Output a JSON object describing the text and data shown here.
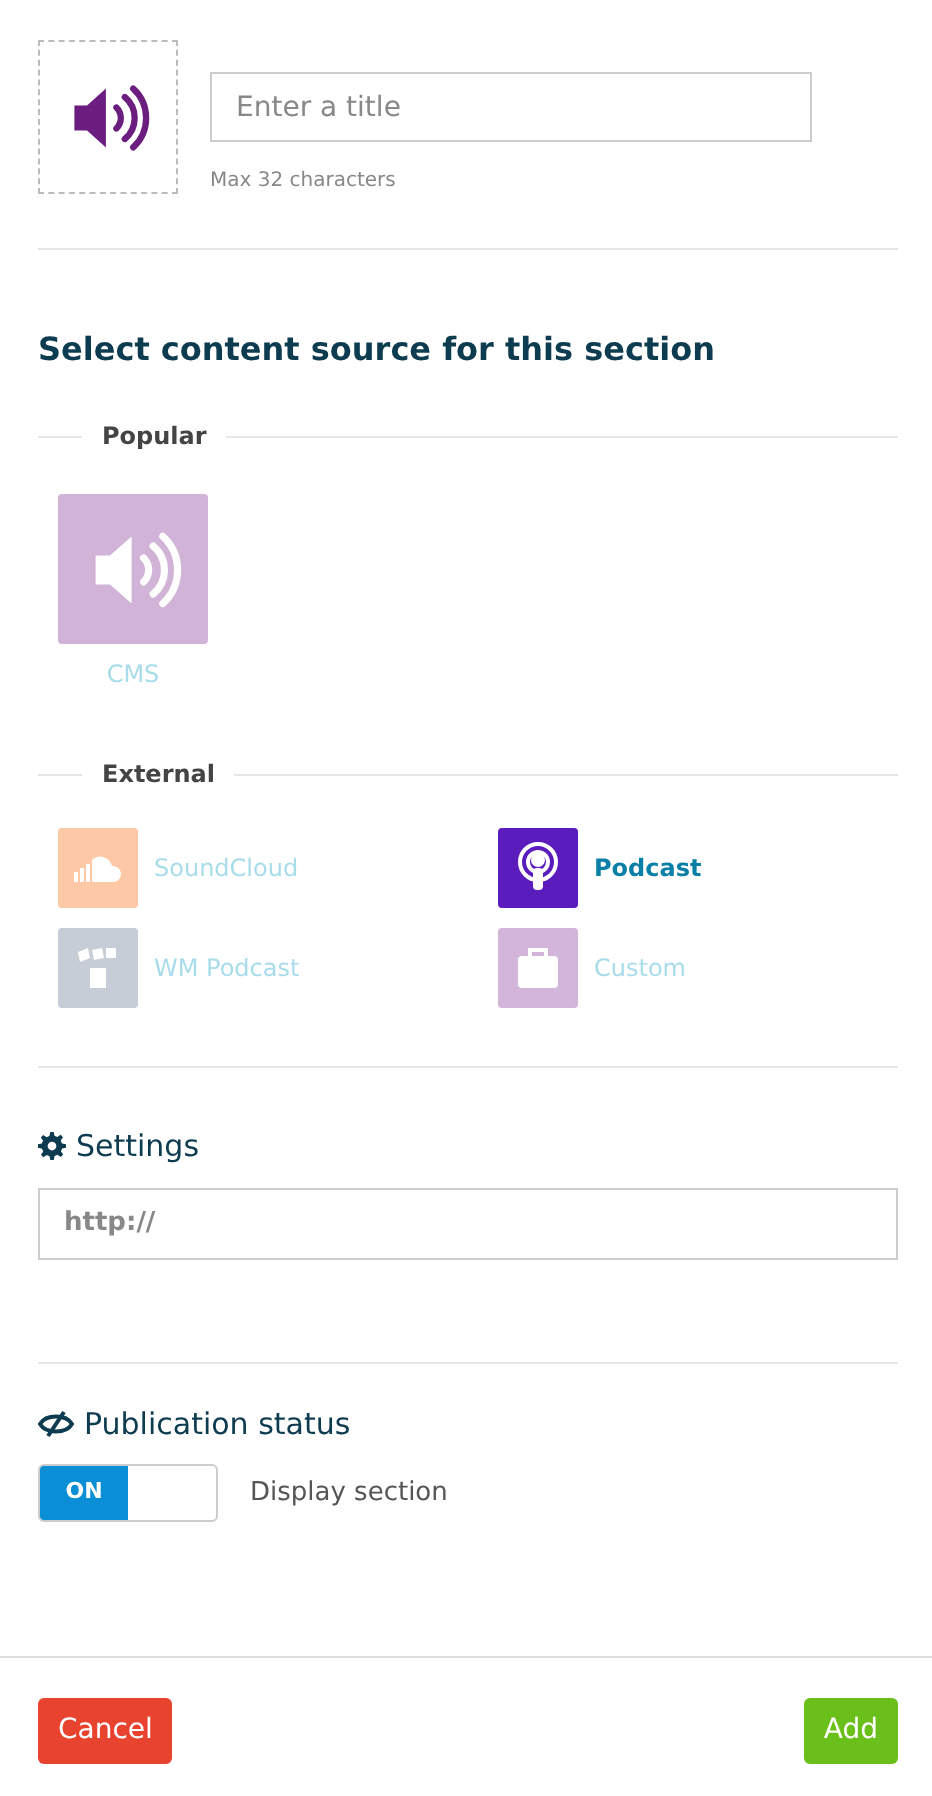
{
  "title_field": {
    "placeholder": "Enter a title",
    "hint": "Max 32 characters"
  },
  "source_heading": "Select content source for this section",
  "groups": [
    {
      "label": "Popular",
      "kind": "large",
      "sources": [
        {
          "label": "CMS",
          "kind": "speaker",
          "color": "#d2b3d8",
          "selected": false
        }
      ]
    },
    {
      "label": "External",
      "kind": "grid",
      "sources": [
        {
          "label": "SoundCloud",
          "kind": "cloud",
          "color": "#fcc8a6",
          "selected": false
        },
        {
          "label": "Podcast",
          "kind": "podcast",
          "color": "#5b1cbd",
          "selected": true
        },
        {
          "label": "WM Podcast",
          "kind": "wm",
          "color": "#c6cdd6",
          "selected": false
        },
        {
          "label": "Custom",
          "kind": "briefcase",
          "color": "#d2b5d8",
          "selected": false
        }
      ]
    }
  ],
  "settings": {
    "heading": "Settings",
    "placeholder": "http://"
  },
  "publication": {
    "heading": "Publication status",
    "toggle_label": "ON",
    "on": true,
    "description": "Display section"
  },
  "buttons": [
    {
      "label": "Cancel",
      "kind": "danger"
    },
    {
      "label": "Add",
      "kind": "success"
    }
  ]
}
